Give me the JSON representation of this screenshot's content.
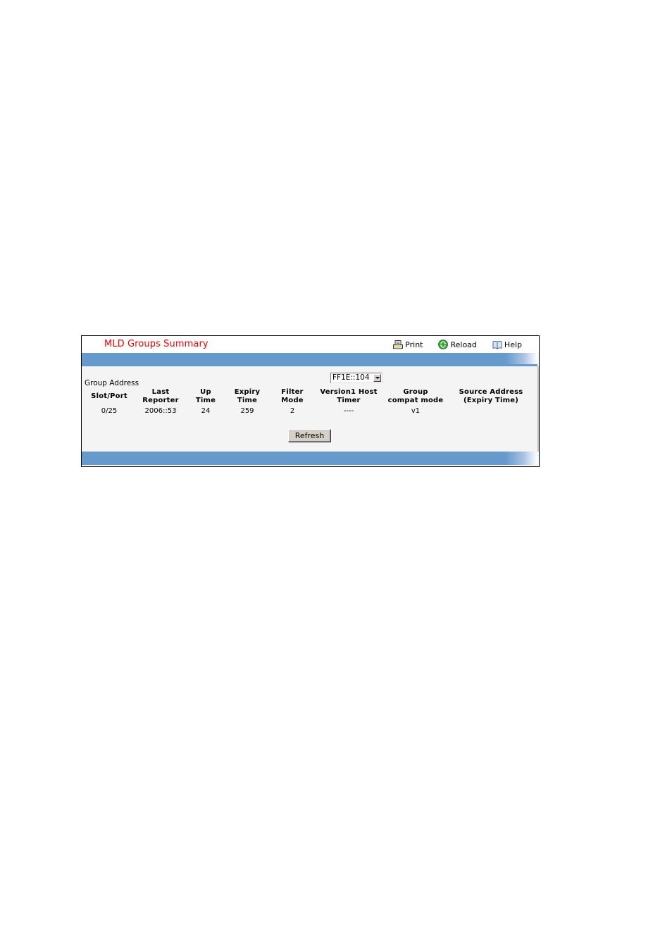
{
  "page": {
    "title": "MLD Groups Summary"
  },
  "toolbar": {
    "print_label": "Print",
    "reload_label": "Reload",
    "help_label": "Help"
  },
  "form": {
    "group_address_label": "Group Address",
    "group_address_selected": "FF1E::104"
  },
  "table": {
    "headers": [
      {
        "line1": "Slot/Port",
        "line2": ""
      },
      {
        "line1": "Last",
        "line2": "Reporter"
      },
      {
        "line1": "Up",
        "line2": "Time"
      },
      {
        "line1": "Expiry",
        "line2": "Time"
      },
      {
        "line1": "Filter",
        "line2": "Mode"
      },
      {
        "line1": "Version1 Host",
        "line2": "Timer"
      },
      {
        "line1": "Group",
        "line2": "compat mode"
      },
      {
        "line1": "Source Address",
        "line2": "(Expiry Time)"
      }
    ],
    "rows": [
      [
        "0/25",
        "2006::53",
        "24",
        "259",
        "2",
        "----",
        "v1",
        ""
      ]
    ]
  },
  "actions": {
    "refresh_label": "Refresh"
  },
  "colors": {
    "title": "#ff0000",
    "bar": "#6699cc",
    "panel_bg": "#f4f4f4"
  }
}
